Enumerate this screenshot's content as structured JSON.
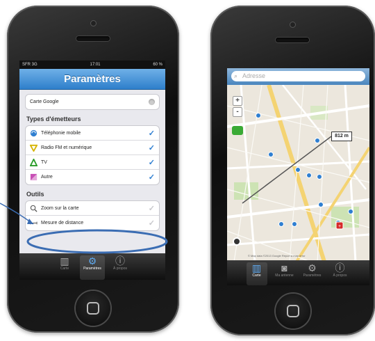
{
  "left_screen": {
    "status": {
      "carrier": "SFR 3G",
      "time": "17:01",
      "battery": "60 %"
    },
    "title": "Paramètres",
    "google_map_row": "Carte Google",
    "section_emitters": "Types d'émetteurs",
    "emitters": [
      {
        "label": "Téléphonie mobile",
        "checked": true
      },
      {
        "label": "Radio FM et numérique",
        "checked": true
      },
      {
        "label": "TV",
        "checked": true
      },
      {
        "label": "Autre",
        "checked": true
      }
    ],
    "section_tools": "Outils",
    "tools": [
      {
        "label": "Zoom sur la carte",
        "checked": false
      },
      {
        "label": "Mesure de distance",
        "checked": false
      }
    ],
    "tabs": [
      {
        "label": "Carte",
        "icon": "map-icon"
      },
      {
        "label": "Paramètres",
        "icon": "gear-icon",
        "active": true
      },
      {
        "label": "À propos",
        "icon": "info-icon"
      }
    ]
  },
  "right_screen": {
    "search_placeholder": "Adresse",
    "zoom_in": "+",
    "zoom_out": "-",
    "distance_label": "812 m",
    "map_footer": "© Map data ©2013 Google   Report a map error",
    "tabs": [
      {
        "label": "Carte",
        "icon": "map-icon",
        "active": true
      },
      {
        "label": "Ma antenne",
        "icon": "camera-icon"
      },
      {
        "label": "Paramètres",
        "icon": "gear-icon"
      },
      {
        "label": "À propos",
        "icon": "info-icon"
      }
    ]
  },
  "colors": {
    "accent": "#2f7fd1",
    "annotation": "#3b6db3",
    "nav_blue": "#2e7fcb"
  }
}
